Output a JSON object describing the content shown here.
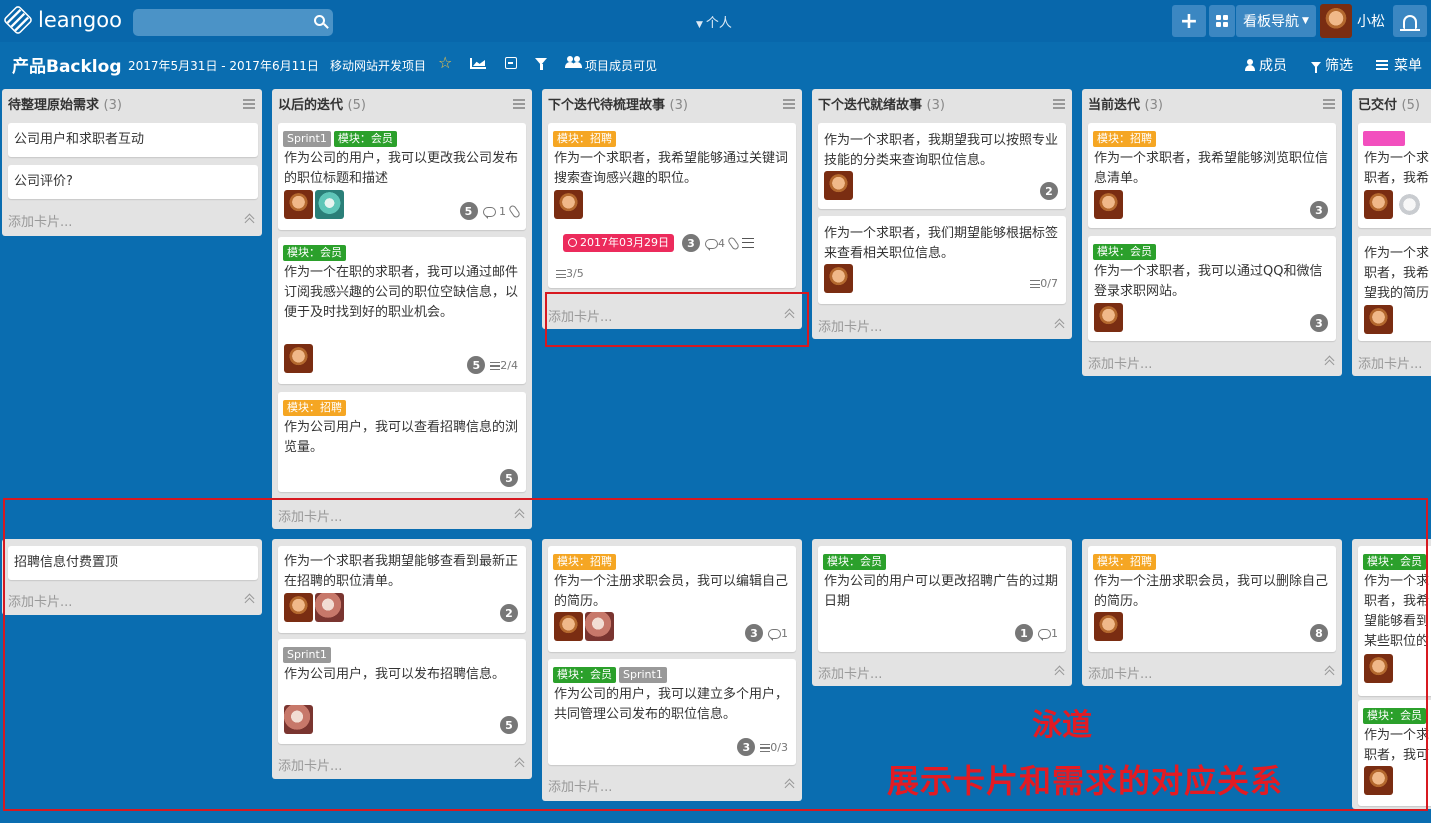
{
  "app": {
    "logo_text": "leangoo",
    "personal": "个人",
    "board_nav": "看板导航",
    "user_name": "小松"
  },
  "board": {
    "title": "产品Backlog",
    "dates": "2017年5月31日 - 2017年6月11日",
    "project": "移动网站开发项目",
    "visibility": "项目成员可见",
    "members_btn": "成员",
    "filter_btn": "筛选",
    "menu_btn": "菜单"
  },
  "common": {
    "add_card": "添加卡片..."
  },
  "lists": [
    {
      "title": "待整理原始需求",
      "count": "(3)"
    },
    {
      "title": "以后的迭代",
      "count": "(5)"
    },
    {
      "title": "下个迭代待梳理故事",
      "count": "(3)"
    },
    {
      "title": "下个迭代就绪故事",
      "count": "(3)"
    },
    {
      "title": "当前迭代",
      "count": "(3)"
    },
    {
      "title": "已交付",
      "count": "(5)"
    }
  ],
  "lane1": {
    "c0": {
      "cards": [
        {
          "text": "公司用户和求职者互动"
        },
        {
          "text": "公司评价?"
        }
      ]
    },
    "c1": {
      "cards": [
        {
          "labels": [
            "Sprint1",
            "模块：会员"
          ],
          "text": "作为公司的用户，我可以更改我公司发布的职位标题和描述",
          "badge": "5",
          "comments": "1"
        },
        {
          "labels": [
            "模块：会员"
          ],
          "text": "作为一个在职的求职者，我可以通过邮件订阅我感兴趣的公司的职位空缺信息，以便于及时找到好的职业机会。",
          "badge": "5",
          "checklist": "2/4"
        },
        {
          "labels": [
            "模块：招聘"
          ],
          "text": "作为公司用户，我可以查看招聘信息的浏览量。",
          "badge": "5"
        }
      ]
    },
    "c2": {
      "cards": [
        {
          "labels": [
            "模块：招聘"
          ],
          "text": "作为一个求职者，我希望能够通过关键词搜索查询感兴趣的职位。",
          "due": "2017年03月29日",
          "badge": "3",
          "comments": "4",
          "checklist": "3/5"
        }
      ]
    },
    "c3": {
      "cards": [
        {
          "text": "作为一个求职者，我期望我可以按照专业技能的分类来查询职位信息。",
          "badge": "2"
        },
        {
          "text": "作为一个求职者，我们期望能够根据标签来查看相关职位信息。",
          "checklist": "0/7"
        }
      ]
    },
    "c4": {
      "cards": [
        {
          "labels": [
            "模块：招聘"
          ],
          "text": "作为一个求职者，我希望能够浏览职位信息清单。",
          "badge": "3"
        },
        {
          "labels": [
            "模块：会员"
          ],
          "text": "作为一个求职者，我可以通过QQ和微信登录求职网站。",
          "badge": "3"
        }
      ]
    },
    "c5": {
      "cards": [
        {
          "text": "作为一个求职者，我希望在忘记密码的时候，"
        },
        {
          "text": "作为一个求职者，我希望我的简历可以被查询到，并且公司用户能够看到我的简历。"
        }
      ]
    }
  },
  "lane2": {
    "c0": {
      "cards": [
        {
          "text": "招聘信息付费置顶"
        }
      ]
    },
    "c1": {
      "cards": [
        {
          "text": "作为一个求职者我期望能够查看到最新正在招聘的职位清单。",
          "badge": "2"
        },
        {
          "labels": [
            "Sprint1"
          ],
          "text": "作为公司用户，我可以发布招聘信息。",
          "badge": "5"
        }
      ]
    },
    "c2": {
      "cards": [
        {
          "labels": [
            "模块：招聘"
          ],
          "text": "作为一个注册求职会员，我可以编辑自己的简历。",
          "badge": "3",
          "comments": "1"
        },
        {
          "labels": [
            "模块：会员",
            "Sprint1"
          ],
          "text": "作为公司的用户，我可以建立多个用户，共同管理公司发布的职位信息。",
          "badge": "3",
          "checklist": "0/3"
        }
      ]
    },
    "c3": {
      "cards": [
        {
          "labels": [
            "模块：会员"
          ],
          "text": "作为公司的用户可以更改招聘广告的过期日期",
          "badge": "1",
          "comments": "1"
        }
      ]
    },
    "c4": {
      "cards": [
        {
          "labels": [
            "模块：招聘"
          ],
          "text": "作为一个注册求职会员，我可以删除自己的简历。",
          "badge": "8"
        }
      ]
    },
    "c5": {
      "cards": [
        {
          "labels": [
            "模块：会员"
          ],
          "text": "作为一个求职者，我希望能够看到某些职位的详细信息，包括薪资水平、地理位置和工作内容。"
        },
        {
          "labels": [
            "模块：会员"
          ],
          "text": "作为一个求职者，我可以通过邮箱注册一个账号。"
        }
      ]
    }
  },
  "annotation": {
    "title": "泳道",
    "subtitle": "展示卡片和需求的对应关系"
  },
  "colors": {
    "board_bg": "#0a6db0",
    "label_member": "#2ba02b",
    "label_recruit": "#f5a623",
    "label_sprint": "#999999",
    "due_red": "#ec2b5c",
    "annotation_red": "#e31b23"
  },
  "icons": [
    "search-icon",
    "plus-icon",
    "grid-icon",
    "bell-icon",
    "star-icon",
    "chart-icon",
    "collapse-icon",
    "filter-icon",
    "members-icon",
    "comment-icon",
    "attachment-icon",
    "checklist-icon",
    "description-icon",
    "clock-icon"
  ]
}
